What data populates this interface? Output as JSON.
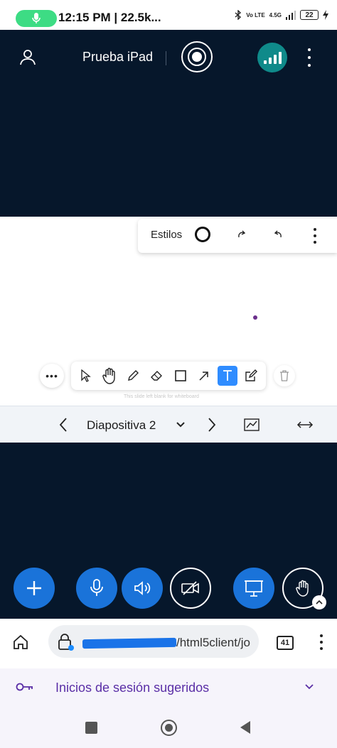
{
  "status": {
    "time_text": "12:15 PM | 22.5k...",
    "net_top": "Vo LTE",
    "net_mid": "4.5G",
    "battery": "22"
  },
  "meeting": {
    "title": "Prueba iPad"
  },
  "styles_panel": {
    "label": "Estilos"
  },
  "whiteboard": {
    "blank_note": "This slide left blank for whiteboard"
  },
  "slide_nav": {
    "current": "Diapositiva 2"
  },
  "browser": {
    "url_suffix": "/html5client/jo",
    "tab_count": "41",
    "suggestion": "Inicios de sesión sugeridos"
  },
  "colors": {
    "dark_bg": "#06172b",
    "accent_blue": "#1a73d9",
    "active_tool": "#2f8cff",
    "connection_teal": "#0f8a8a",
    "suggest_purple": "#5a2ea6"
  }
}
